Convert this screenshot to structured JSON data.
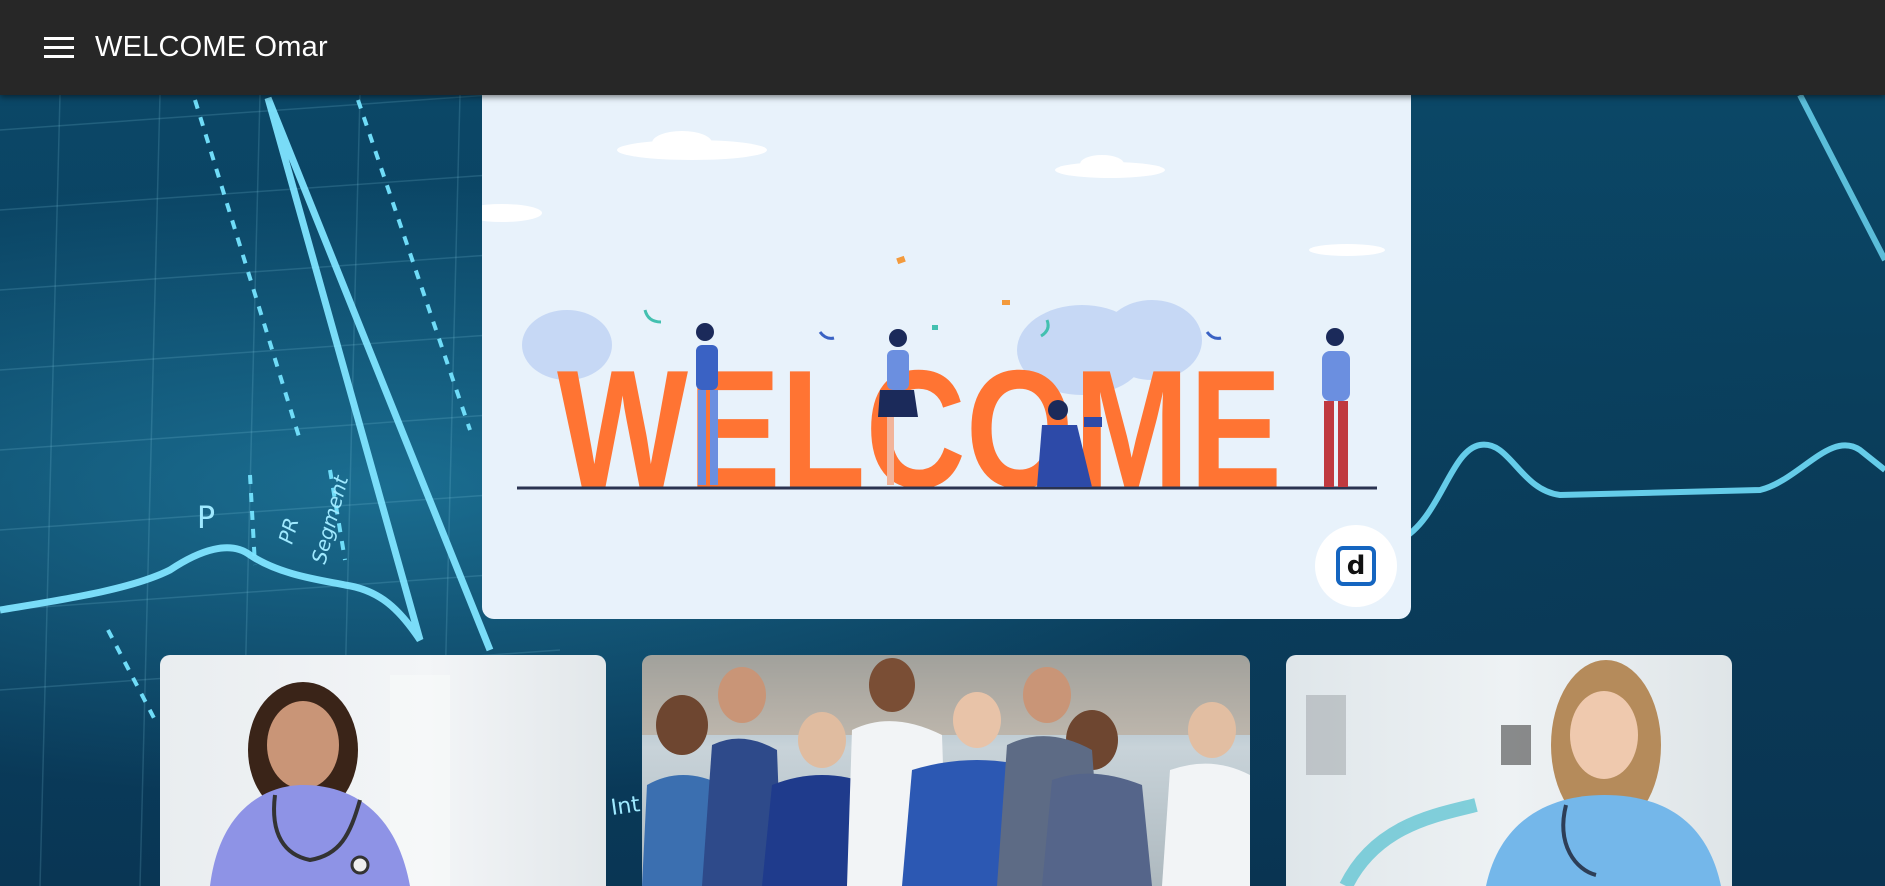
{
  "header": {
    "title": "WELCOME Omar",
    "menu_icon": "menu-icon"
  },
  "hero": {
    "banner_word": "WELCOME",
    "badge_letter": "d",
    "colors": {
      "letters": "#ff7433",
      "card_bg": "#e8f2fb",
      "badge_border": "#1565c0"
    }
  },
  "background": {
    "ecg_labels": {
      "p": "P",
      "pr_1": "PR",
      "pr_2": "Segment",
      "int": "Int"
    }
  },
  "photos": [
    {
      "name": "single-nurse-purple-scrubs"
    },
    {
      "name": "medical-team-group"
    },
    {
      "name": "single-nurse-blue-scrubs"
    }
  ],
  "colors": {
    "appbar": "#272727",
    "background": "#0b3a55",
    "ecg_line": "#7fe4ff"
  }
}
